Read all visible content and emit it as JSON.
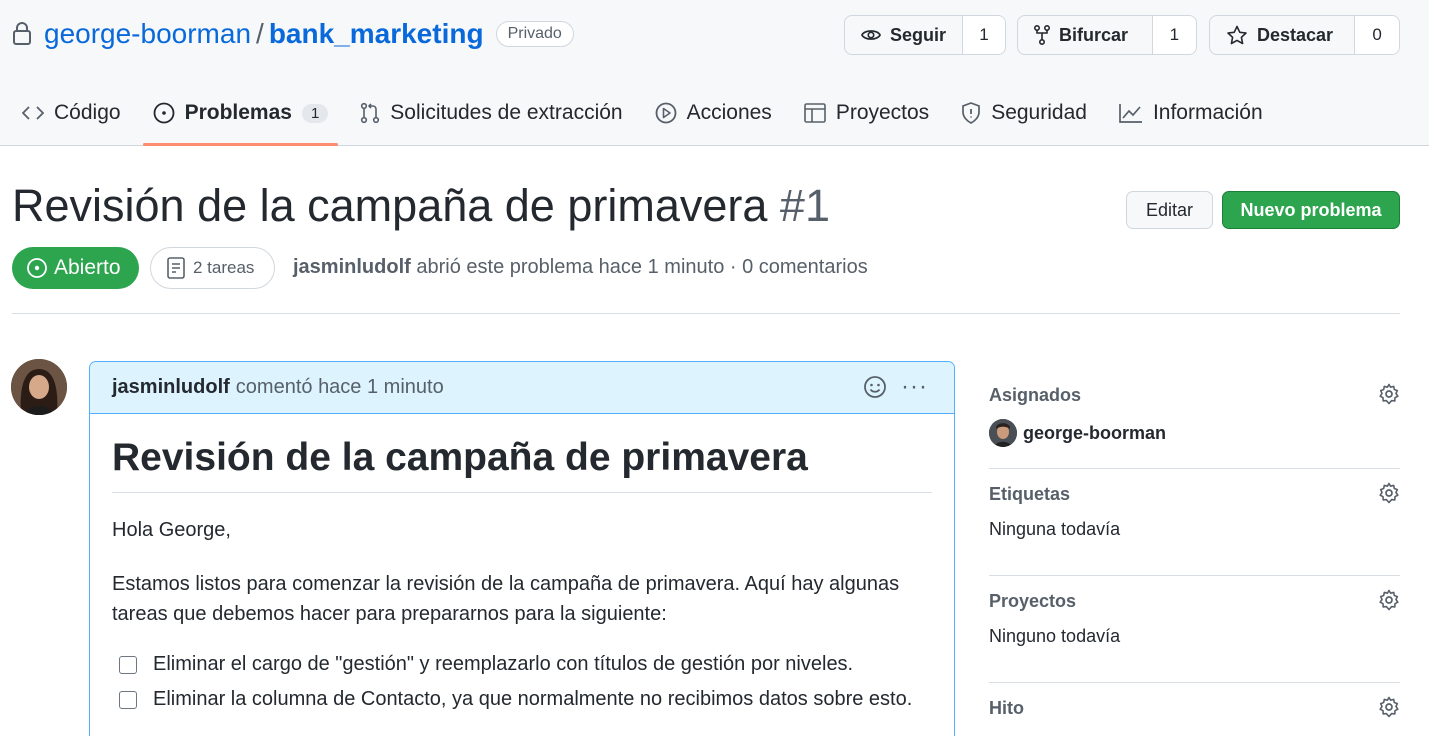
{
  "repo": {
    "owner": "george-boorman",
    "separator": "/",
    "name": "bank_marketing",
    "visibility": "Privado"
  },
  "repo_actions": {
    "watch": {
      "label": "Seguir",
      "count": "1"
    },
    "fork": {
      "label": "Bifurcar",
      "count": "1"
    },
    "star": {
      "label": "Destacar",
      "count": "0"
    }
  },
  "tabs": [
    {
      "label": "Código",
      "icon": "code-icon"
    },
    {
      "label": "Problemas",
      "icon": "issue-icon",
      "count": "1",
      "active": true
    },
    {
      "label": "Solicitudes de extracción",
      "icon": "pull-request-icon"
    },
    {
      "label": "Acciones",
      "icon": "play-icon"
    },
    {
      "label": "Proyectos",
      "icon": "table-icon"
    },
    {
      "label": "Seguridad",
      "icon": "shield-icon"
    },
    {
      "label": "Información",
      "icon": "graph-icon"
    }
  ],
  "issue": {
    "title": "Revisión de la campaña de primavera",
    "number": "#1",
    "state": "Abierto",
    "tasks": "2 tareas",
    "author": "jasminludolf",
    "meta_rest": "abrió este problema hace 1 minuto · 0 comentarios",
    "edit_label": "Editar",
    "new_label": "Nuevo problema"
  },
  "comment": {
    "author": "jasminludolf",
    "time": "comentó hace 1 minuto",
    "heading": "Revisión de la campaña de primavera",
    "greeting": "Hola George,",
    "intro_line1": "Estamos listos para comenzar la revisión de la campaña de primavera. Aquí hay algunas",
    "intro_line2": "tareas que debemos hacer para prepararnos para la siguiente:",
    "tasks": [
      "Eliminar el cargo de \"gestión\" y reemplazarlo con títulos de gestión por niveles.",
      "Eliminar la columna de Contacto, ya que normalmente no recibimos datos sobre esto."
    ]
  },
  "sidebar": {
    "assignees": {
      "title": "Asignados",
      "value": "george-boorman"
    },
    "labels": {
      "title": "Etiquetas",
      "value": "Ninguna todavía"
    },
    "projects": {
      "title": "Proyectos",
      "value": "Ninguno todavía"
    },
    "milestone": {
      "title": "Hito"
    }
  },
  "colors": {
    "link": "#0969da",
    "open_green": "#2da44e",
    "active_tab_underline": "#fd8c73",
    "comment_header": "#ddf4ff",
    "comment_border": "#54aeff"
  }
}
